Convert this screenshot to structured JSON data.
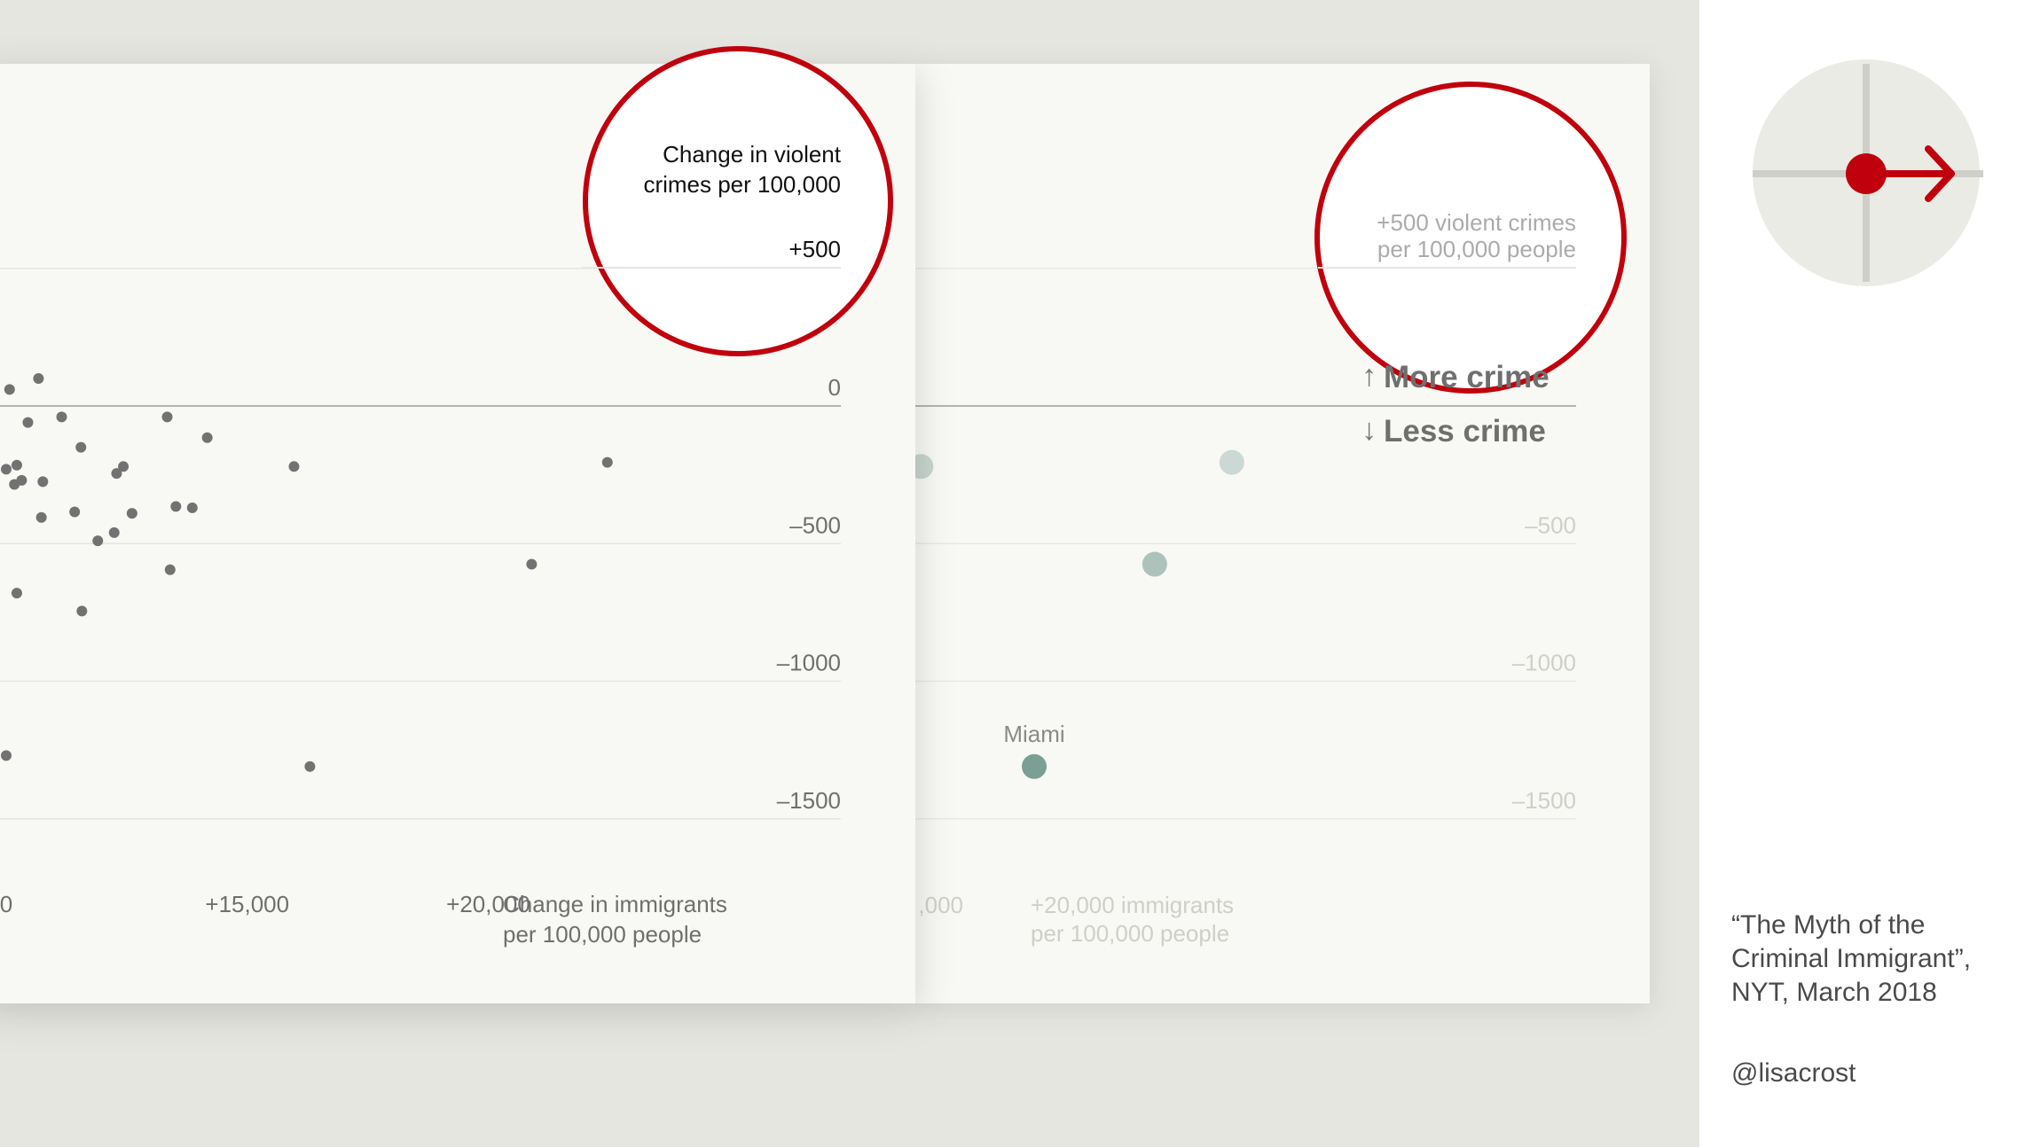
{
  "colors": {
    "accent_red": "#c0000c",
    "dot_dark": "#727272",
    "dot_teal": "#7a9f95",
    "panel_bg": "#f8f8f4",
    "page_bg": "#e6e6e1"
  },
  "icons": {
    "navigation": "crosshair-arrow-right-icon"
  },
  "chart_data": [
    {
      "type": "scatter",
      "panel": "front",
      "title": "",
      "ylabel": "Change in violent crimes per 100,000",
      "xlabel": "Change in immigrants per 100,000 people",
      "ylim": [
        -1800,
        700
      ],
      "y_ticks": [
        {
          "value": 500,
          "label": "+500"
        },
        {
          "value": 0,
          "label": "0"
        },
        {
          "value": -500,
          "label": "–500"
        },
        {
          "value": -1000,
          "label": "–1000"
        },
        {
          "value": -1500,
          "label": "–1500"
        }
      ],
      "x_ticks": [
        {
          "value": 10000,
          "label": "0"
        },
        {
          "value": 15000,
          "label": "+15,000"
        },
        {
          "value": 20000,
          "label": "+20,000"
        }
      ],
      "grid": true,
      "points": [
        {
          "x": 10070,
          "y": 60
        },
        {
          "x": 10670,
          "y": 100
        },
        {
          "x": 10450,
          "y": -60
        },
        {
          "x": 11150,
          "y": -40
        },
        {
          "x": 10000,
          "y": -230
        },
        {
          "x": 10220,
          "y": -215
        },
        {
          "x": 10320,
          "y": -270
        },
        {
          "x": 10170,
          "y": -285
        },
        {
          "x": 10760,
          "y": -275
        },
        {
          "x": 11550,
          "y": -150
        },
        {
          "x": 12430,
          "y": -220
        },
        {
          "x": 12290,
          "y": -245
        },
        {
          "x": 12610,
          "y": -390
        },
        {
          "x": 11420,
          "y": -385
        },
        {
          "x": 10730,
          "y": -405
        },
        {
          "x": 13520,
          "y": -365
        },
        {
          "x": 13860,
          "y": -370
        },
        {
          "x": 11900,
          "y": -490
        },
        {
          "x": 12240,
          "y": -460
        },
        {
          "x": 13340,
          "y": -40
        },
        {
          "x": 14170,
          "y": -115
        },
        {
          "x": 15970,
          "y": -220
        },
        {
          "x": 22470,
          "y": -205
        },
        {
          "x": 20900,
          "y": -575
        },
        {
          "x": 13400,
          "y": -595
        },
        {
          "x": 10220,
          "y": -680
        },
        {
          "x": 11570,
          "y": -745
        },
        {
          "x": 10000,
          "y": -1270
        },
        {
          "x": 16300,
          "y": -1310
        }
      ]
    },
    {
      "type": "scatter",
      "panel": "back",
      "title": "",
      "ylabel": "+500 violent crimes per 100,000 people",
      "xlabel": "+20,000 immigrants per 100,000 people",
      "ylim": [
        -1800,
        700
      ],
      "y_ticks": [
        {
          "value": 500,
          "label": "+500"
        },
        {
          "value": 0,
          "label": ""
        },
        {
          "value": -500,
          "label": "–500"
        },
        {
          "value": -1000,
          "label": "–1000"
        },
        {
          "value": -1500,
          "label": "–1500"
        }
      ],
      "x_ticks": [
        {
          "value": 15000,
          "label": ",000"
        }
      ],
      "direction_labels": {
        "up": "More crime",
        "down": "Less crime"
      },
      "grid": true,
      "points": [
        {
          "x": 15150,
          "y": -115,
          "opacity": 0.45
        },
        {
          "x": 16950,
          "y": -220,
          "opacity": 0.4
        },
        {
          "x": 23400,
          "y": -205,
          "opacity": 0.35
        },
        {
          "x": 15200,
          "y": -370,
          "opacity": 0.55
        },
        {
          "x": 21800,
          "y": -575,
          "opacity": 0.6
        },
        {
          "x": 19300,
          "y": -1310,
          "opacity": 1.0,
          "label": "Miami"
        }
      ]
    }
  ],
  "source": {
    "lines": [
      "“The Myth of the",
      "Criminal Immigrant”,",
      "NYT, March 2018"
    ],
    "handle": "@lisacrost"
  }
}
